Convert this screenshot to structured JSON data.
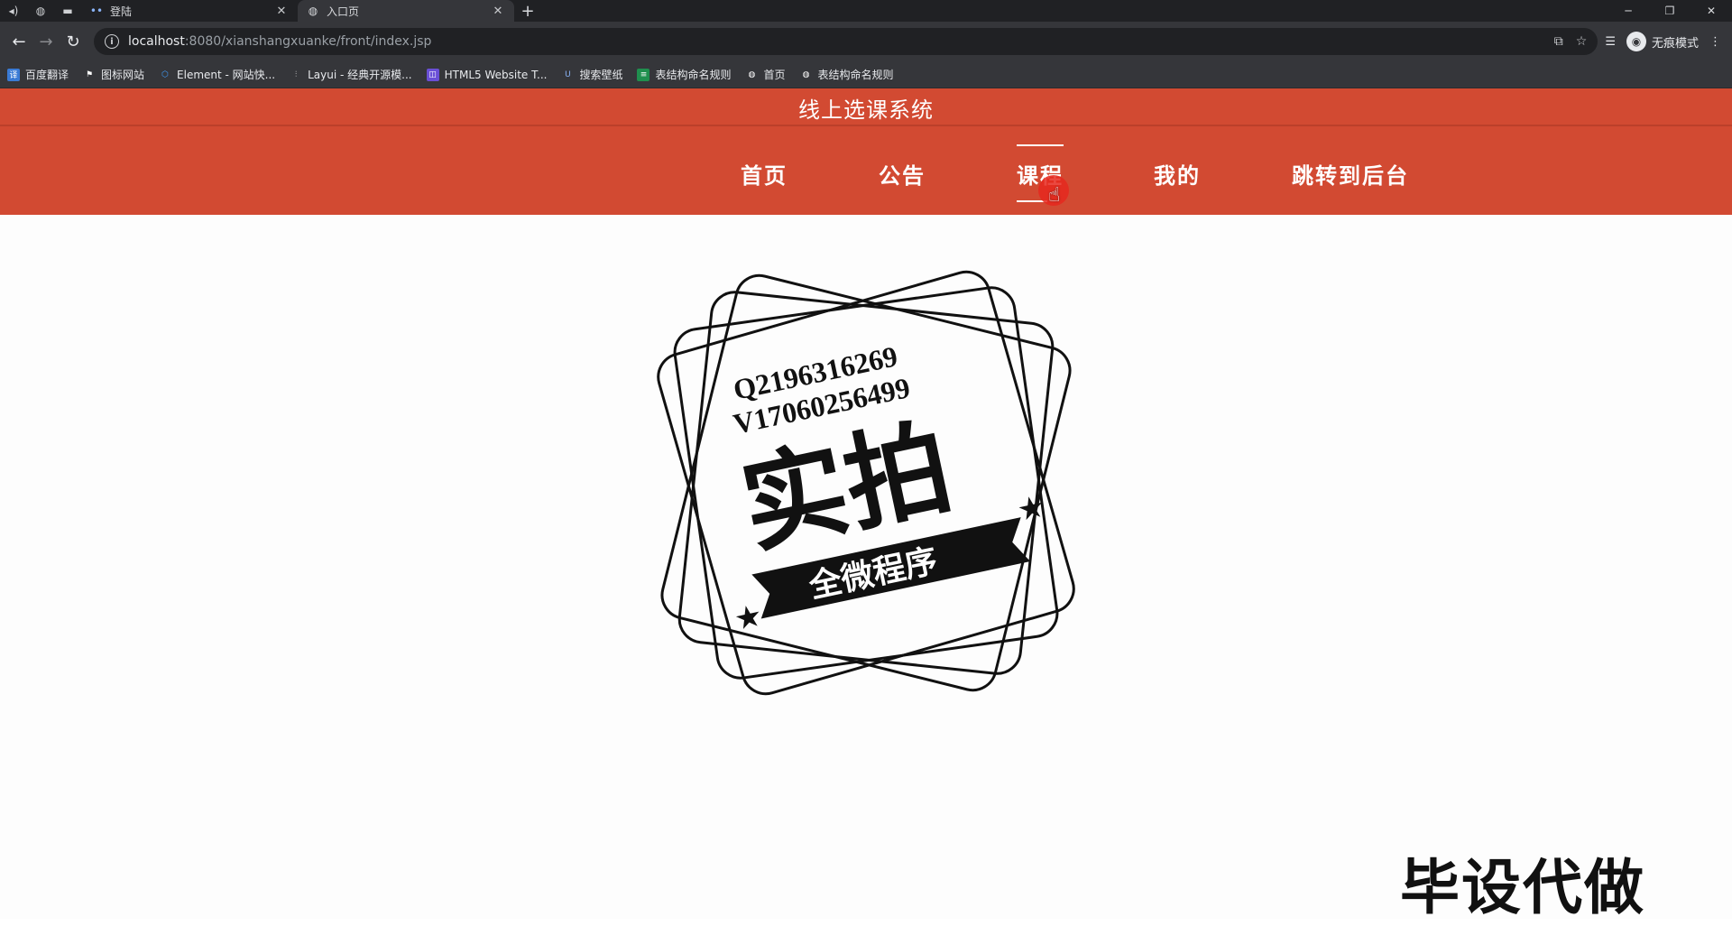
{
  "browser": {
    "tabs": [
      {
        "title": "登陆",
        "active": false
      },
      {
        "title": "入口页",
        "active": true
      }
    ],
    "url_host": "localhost",
    "url_rest": ":8080/xianshangxuanke/front/index.jsp",
    "profile_label": "无痕模式",
    "bookmarks": [
      {
        "label": "百度翻译",
        "icon": "translate-icon",
        "color": "#3a7bd5"
      },
      {
        "label": "图标网站",
        "icon": "flag-icon",
        "color": "#35363a"
      },
      {
        "label": "Element - 网站快...",
        "icon": "element-icon",
        "color": "#409eff"
      },
      {
        "label": "Layui - 经典开源模...",
        "icon": "layui-icon",
        "color": "#35363a"
      },
      {
        "label": "HTML5 Website T...",
        "icon": "html5-icon",
        "color": "#6a4fd6"
      },
      {
        "label": "搜索壁纸",
        "icon": "wallpaper-icon",
        "color": "#35363a"
      },
      {
        "label": "表结构命名规则",
        "icon": "sheet-icon",
        "color": "#1f8f4e"
      },
      {
        "label": "首页",
        "icon": "globe-icon",
        "color": "#35363a"
      },
      {
        "label": "表结构命名规则",
        "icon": "globe-icon",
        "color": "#35363a"
      }
    ]
  },
  "site": {
    "title": "线上选课系统",
    "nav": [
      {
        "label": "首页",
        "active": false
      },
      {
        "label": "公告",
        "active": false
      },
      {
        "label": "课程",
        "active": true
      },
      {
        "label": "我的",
        "active": false
      },
      {
        "label": "跳转到后台",
        "active": false
      }
    ],
    "accent_color": "#d24a32"
  },
  "overlay": {
    "stamp_line1": "Q2196316269",
    "stamp_line2": "V17060256499",
    "stamp_main": "实拍",
    "stamp_banner": "全微程序",
    "watermark": "毕设代做"
  }
}
